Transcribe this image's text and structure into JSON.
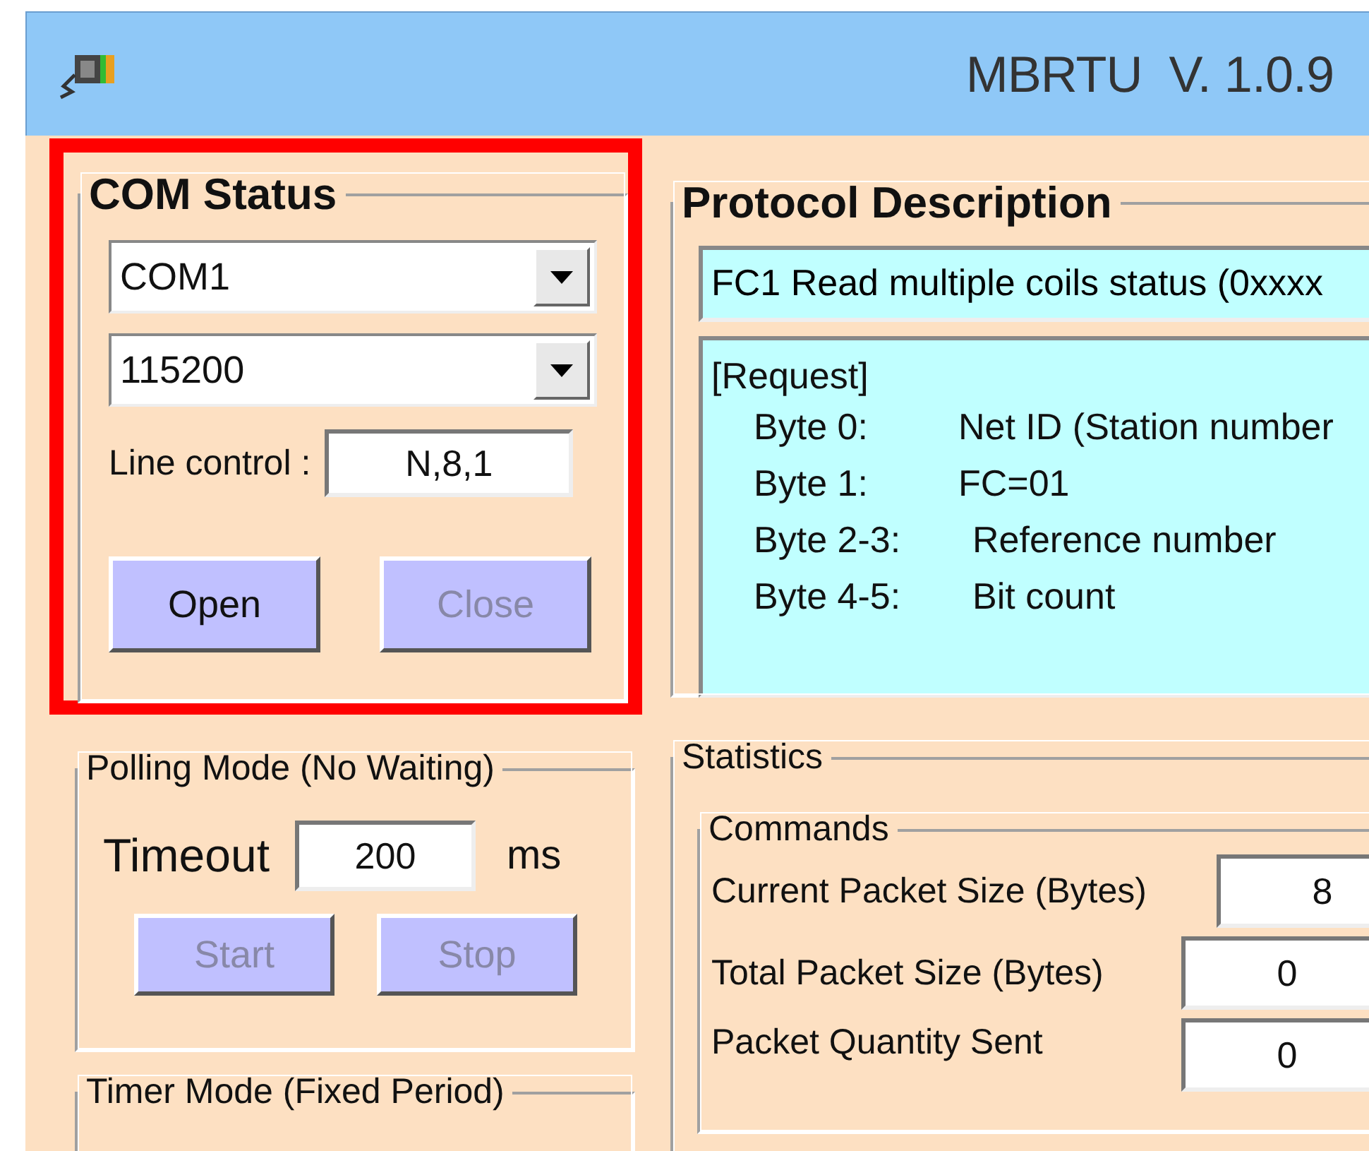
{
  "window": {
    "title": "MBRTU  V. 1.0.9"
  },
  "com_status": {
    "title": "COM Status",
    "highlighted": true,
    "port": "COM1",
    "baud": "115200",
    "line_control_label": "Line control :",
    "line_control": "N,8,1",
    "buttons": [
      {
        "label": "Open",
        "disabled": false
      },
      {
        "label": "Close",
        "disabled": true
      }
    ]
  },
  "polling_mode": {
    "title": "Polling Mode (No Waiting)",
    "timeout_label": "Timeout",
    "timeout": "200",
    "unit": "ms",
    "buttons": [
      {
        "label": "Start",
        "disabled": true
      },
      {
        "label": "Stop",
        "disabled": true
      }
    ]
  },
  "timer_mode": {
    "title": "Timer Mode (Fixed Period)"
  },
  "protocol_description": {
    "title": "Protocol Description",
    "function": "FC1  Read multiple coils status (0xxxx",
    "request_title": "[Request]",
    "request": [
      {
        "field": "Byte 0:",
        "meaning": "Net ID (Station number"
      },
      {
        "field": "Byte 1:",
        "meaning": "FC=01"
      },
      {
        "field": "Byte 2-3:",
        "meaning": "Reference number"
      },
      {
        "field": "Byte 4-5:",
        "meaning": "Bit count"
      }
    ]
  },
  "statistics": {
    "title": "Statistics",
    "commands": {
      "title": "Commands",
      "rows": [
        {
          "label": "Current Packet Size (Bytes)",
          "value": "8"
        },
        {
          "label": "Total Packet Size (Bytes)",
          "value": "0"
        },
        {
          "label": "Packet Quantity Sent",
          "value": "0"
        }
      ]
    }
  }
}
